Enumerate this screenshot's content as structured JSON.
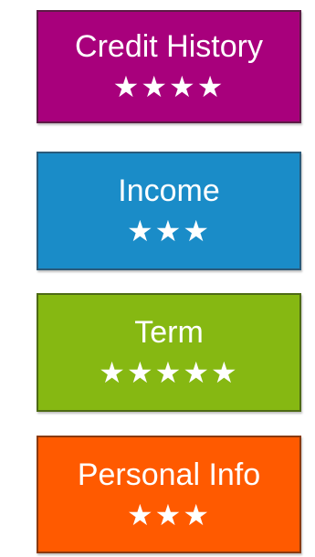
{
  "cards": [
    {
      "label": "Credit History",
      "stars": "★★★★",
      "rating": 4,
      "color": "#a8007c",
      "border": "#5c1a45"
    },
    {
      "label": "Income",
      "stars": "★★★",
      "rating": 3,
      "color": "#1a8cc8",
      "border": "#2a5a7a"
    },
    {
      "label": "Term",
      "stars": "★★★★★",
      "rating": 5,
      "color": "#86b812",
      "border": "#4d6a14"
    },
    {
      "label": "Personal Info",
      "stars": "★★★",
      "rating": 3,
      "color": "#ff5a00",
      "border": "#8a3a10"
    }
  ]
}
